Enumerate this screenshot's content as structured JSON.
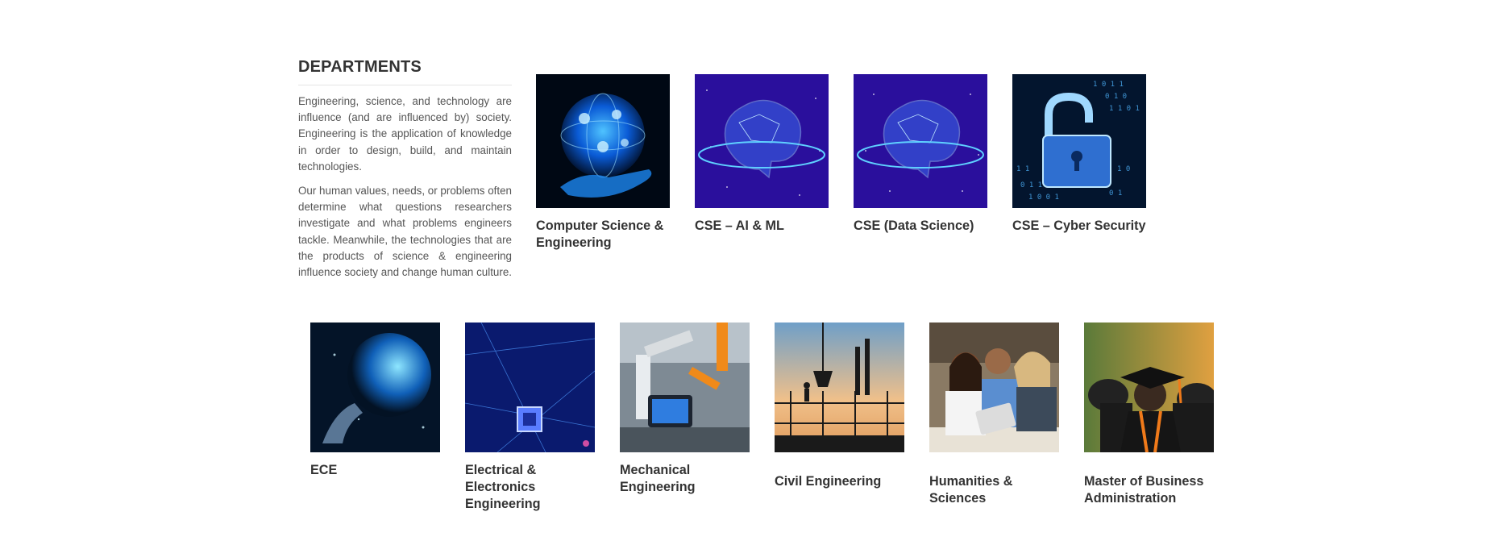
{
  "section": {
    "title": "DEPARTMENTS",
    "paragraphs": [
      "Engineering, science, and technology are influence (and are influenced by) society. Engineering is the application of knowledge in order to design, build, and maintain technologies.",
      "Our human values, needs, or problems often determine what questions researchers investigate and what problems engineers tackle. Meanwhile, the technologies that are the products of science & engineering influence society and change human culture."
    ]
  },
  "departments": [
    {
      "label": "Computer Science & Engineering",
      "image": "digital-globe-in-hand-icon"
    },
    {
      "label": "CSE – AI & ML",
      "image": "ai-brain-icon"
    },
    {
      "label": "CSE (Data Science)",
      "image": "ai-brain-icon"
    },
    {
      "label": "CSE – Cyber Security",
      "image": "padlock-binary-icon"
    },
    {
      "label": "ECE",
      "image": "digital-earth-icon"
    },
    {
      "label": "Electrical & Electronics Engineering",
      "image": "circuit-chip-icon"
    },
    {
      "label": "Mechanical Engineering",
      "image": "robotic-arm-icon"
    },
    {
      "label": "Civil Engineering",
      "image": "construction-site-icon"
    },
    {
      "label": "Humanities & Sciences",
      "image": "students-reading-icon"
    },
    {
      "label": "Master of Business Administration",
      "image": "graduation-cap-icon"
    }
  ],
  "colors": {
    "text": "#333333",
    "body_text": "#555555",
    "divider": "#e4e4e4"
  }
}
